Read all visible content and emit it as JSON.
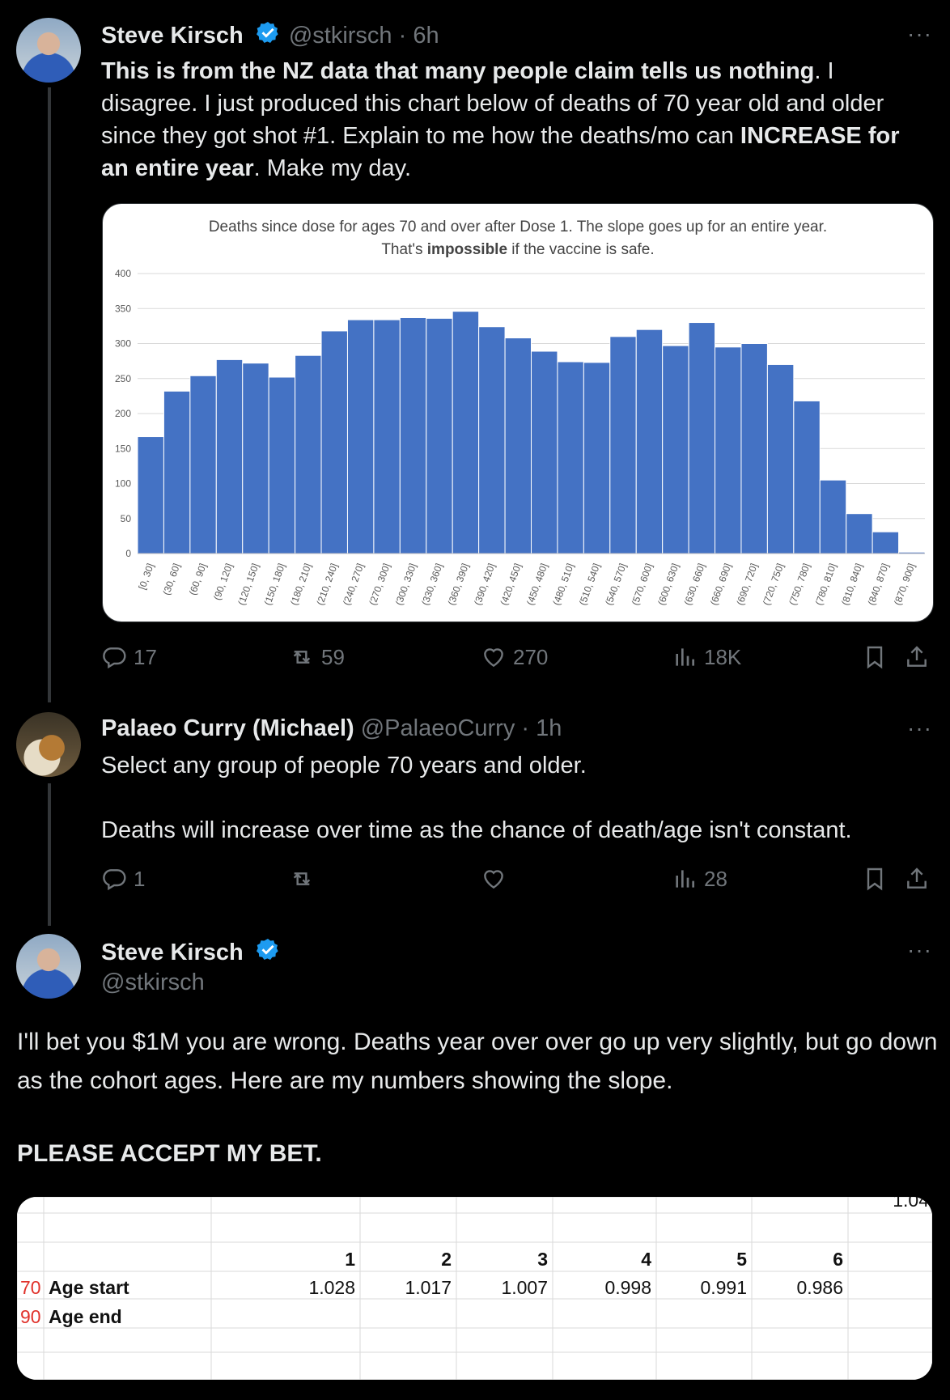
{
  "tweet1": {
    "author_name": "Steve Kirsch",
    "author_handle": "@stkirsch",
    "time": "· 6h",
    "more": "···",
    "text_bold_1": "This is from the NZ data that many people claim tells us nothing",
    "text_1": ". I disagree. I just produced this chart below of deaths of 70 year old and older since they got shot #1. Explain to me how the deaths/mo can ",
    "text_bold_2": "INCREASE for an entire year",
    "text_2": ". Make my day.",
    "stats": {
      "replies": "17",
      "reposts": "59",
      "likes": "270",
      "views": "18K"
    }
  },
  "chart_data": {
    "type": "bar",
    "title_line1": "Deaths since dose for ages 70 and over after Dose 1. The slope goes up for an entire year.",
    "title_line2_pre": "That's ",
    "title_line2_bold": "impossible",
    "title_line2_post": " if the vaccine is safe.",
    "xlabel": "",
    "ylabel": "",
    "ylim": [
      0,
      400
    ],
    "yticks": [
      0,
      50,
      100,
      150,
      200,
      250,
      300,
      350,
      400
    ],
    "grid": true,
    "bar_color": "#4472c4",
    "categories": [
      "[0, 30]",
      "(30, 60]",
      "(60, 90]",
      "(90, 120]",
      "(120, 150]",
      "(150, 180]",
      "(180, 210]",
      "(210, 240]",
      "(240, 270]",
      "(270, 300]",
      "(300, 330]",
      "(330, 360]",
      "(360, 390]",
      "(390, 420]",
      "(420, 450]",
      "(450, 480]",
      "(480, 510]",
      "(510, 540]",
      "(540, 570]",
      "(570, 600]",
      "(600, 630]",
      "(630, 660]",
      "(660, 690]",
      "(690, 720]",
      "(720, 750]",
      "(750, 780]",
      "(780, 810]",
      "(810, 840]",
      "(840, 870]",
      "(870, 900]"
    ],
    "values": [
      167,
      232,
      254,
      277,
      272,
      252,
      283,
      318,
      334,
      334,
      337,
      336,
      346,
      324,
      308,
      289,
      274,
      273,
      310,
      320,
      297,
      330,
      295,
      300,
      270,
      218,
      105,
      57,
      31,
      2
    ]
  },
  "tweet2": {
    "author_name": "Palaeo Curry (Michael)",
    "author_handle": "@PalaeoCurry",
    "time": "· 1h",
    "more": "···",
    "line1": "Select any group of people 70 years and older.",
    "line2": "Deaths will increase over time as the chance of death/age isn't constant.",
    "stats": {
      "replies": "1",
      "views": "28"
    }
  },
  "tweet3": {
    "author_name": "Steve Kirsch",
    "author_handle": "@stkirsch",
    "more": "···",
    "text": "I'll bet you $1M you are wrong. Deaths year over over go up very slightly, but go down as the cohort ages. Here are my numbers showing the slope.",
    "text_bold": "PLEASE ACCEPT MY BET.",
    "table": {
      "partial_top_value": "1.04",
      "headers": [
        "1",
        "2",
        "3",
        "4",
        "5",
        "6"
      ],
      "rows": [
        {
          "num": "70",
          "label": "Age start",
          "values": [
            "1.028",
            "1.017",
            "1.007",
            "0.998",
            "0.991",
            "0.986"
          ]
        },
        {
          "num": "90",
          "label": "Age end",
          "values": [
            "",
            "",
            "",
            "",
            "",
            ""
          ]
        }
      ]
    }
  },
  "colors": {
    "accent_blue": "#1d9bf0",
    "verified": "#1d9bf0",
    "muted": "#71767b",
    "red_number": "#e0322b"
  }
}
